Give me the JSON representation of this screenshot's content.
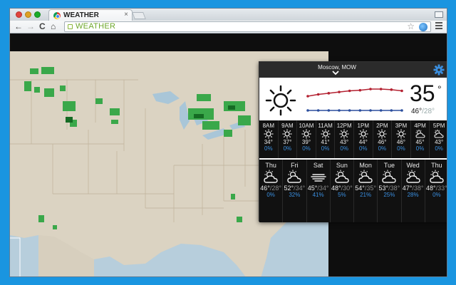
{
  "browser": {
    "tab_title": "WEATHER",
    "tab_close": "×",
    "url": "WEATHER",
    "nav": {
      "back": "←",
      "forward": "→",
      "reload": "C",
      "home": "⌂",
      "star": "☆"
    }
  },
  "weather": {
    "city": "Moscow, MOW",
    "current": {
      "temp": "35",
      "deg": "°",
      "hi": "46°",
      "sep": "/",
      "lo": "28°"
    },
    "hourly": [
      {
        "time": "8AM",
        "temp": "34°",
        "pop": "0%",
        "icon": "sun-icon"
      },
      {
        "time": "9AM",
        "temp": "37°",
        "pop": "0%",
        "icon": "sun-icon"
      },
      {
        "time": "10AM",
        "temp": "39°",
        "pop": "0%",
        "icon": "sun-icon"
      },
      {
        "time": "11AM",
        "temp": "41°",
        "pop": "0%",
        "icon": "sun-icon"
      },
      {
        "time": "12PM",
        "temp": "43°",
        "pop": "0%",
        "icon": "sun-icon"
      },
      {
        "time": "1PM",
        "temp": "44°",
        "pop": "0%",
        "icon": "sun-icon"
      },
      {
        "time": "2PM",
        "temp": "46°",
        "pop": "0%",
        "icon": "sun-icon"
      },
      {
        "time": "3PM",
        "temp": "46°",
        "pop": "0%",
        "icon": "sun-icon"
      },
      {
        "time": "4PM",
        "temp": "45°",
        "pop": "0%",
        "icon": "partly-cloudy-icon"
      },
      {
        "time": "5PM",
        "temp": "43°",
        "pop": "0%",
        "icon": "partly-cloudy-icon"
      }
    ],
    "daily": [
      {
        "day": "Thu",
        "hi": "46°",
        "lo": "28°",
        "pop": "0%",
        "icon": "partly-cloudy-icon"
      },
      {
        "day": "Fri",
        "hi": "52°",
        "lo": "34°",
        "pop": "32%",
        "icon": "partly-cloudy-icon"
      },
      {
        "day": "Sat",
        "hi": "45°",
        "lo": "34°",
        "pop": "41%",
        "icon": "wind-icon"
      },
      {
        "day": "Sun",
        "hi": "48°",
        "lo": "30°",
        "pop": "5%",
        "icon": "partly-cloudy-icon"
      },
      {
        "day": "Mon",
        "hi": "54°",
        "lo": "35°",
        "pop": "21%",
        "icon": "partly-cloudy-icon"
      },
      {
        "day": "Tue",
        "hi": "53°",
        "lo": "38°",
        "pop": "25%",
        "icon": "partly-cloudy-icon"
      },
      {
        "day": "Wed",
        "hi": "47°",
        "lo": "38°",
        "pop": "28%",
        "icon": "partly-cloudy-icon"
      },
      {
        "day": "Thu",
        "hi": "48°",
        "lo": "33°",
        "pop": "0%",
        "icon": "partly-cloudy-icon"
      }
    ],
    "colors": {
      "accent": "#1a95e0",
      "pop_blue": "#3a8fe0",
      "high_line": "#b32030",
      "low_line": "#2c4f9e"
    }
  }
}
